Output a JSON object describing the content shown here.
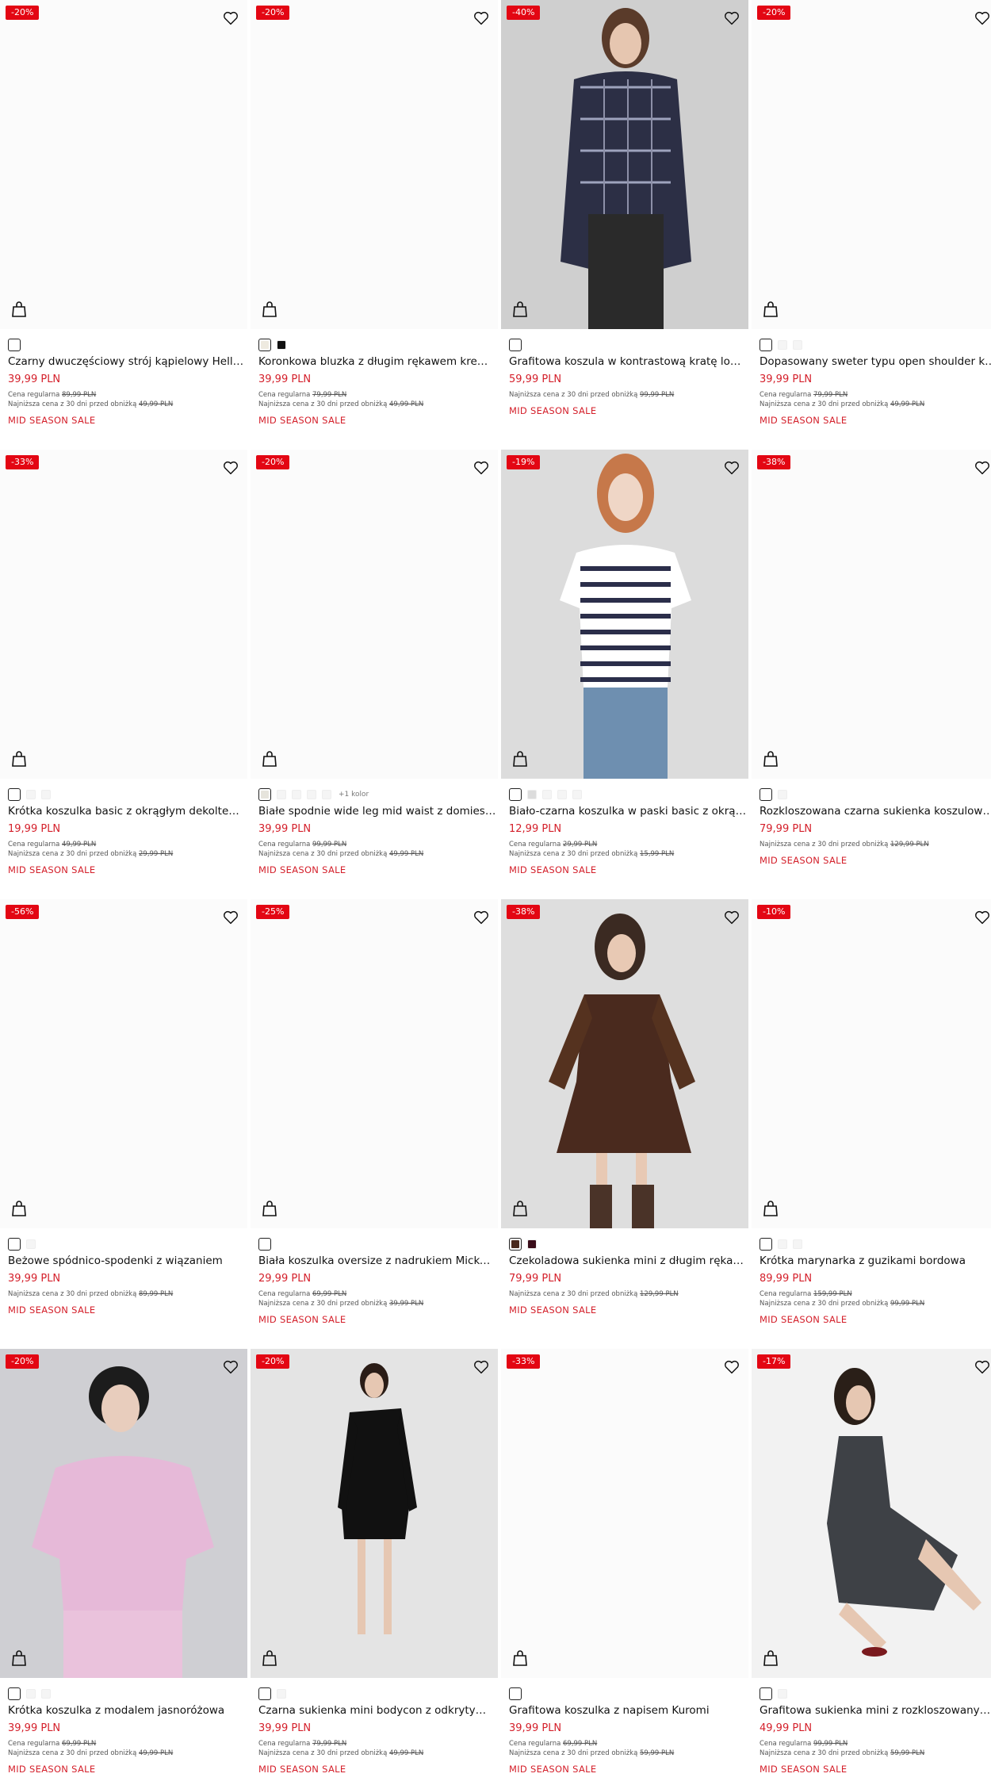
{
  "labels": {
    "regular": "Cena regularna",
    "lowest": "Najniższa cena z 30 dni przed obniżką"
  },
  "colors": {
    "accent": "#d41f2a",
    "badge": "#e30613"
  },
  "products": [
    {
      "badge": "-20%",
      "name": "Czarny dwuczęściowy strój kąpielowy Hello Kitty",
      "price": "39,99 PLN",
      "regular": "89,99 PLN",
      "lowest": "49,99 PLN",
      "sale": "MID SEASON SALE",
      "swatches": [
        "#ffffff"
      ],
      "more": "",
      "photo": "none"
    },
    {
      "badge": "-20%",
      "name": "Koronkowa bluzka z długim rękawem kremowa",
      "price": "39,99 PLN",
      "regular": "79,99 PLN",
      "lowest": "49,99 PLN",
      "sale": "MID SEASON SALE",
      "swatches": [
        "#eeeae0",
        "#111111"
      ],
      "more": "",
      "photo": "none"
    },
    {
      "badge": "-40%",
      "name": "Grafitowa koszula w kontrastową kratę loose fit",
      "price": "59,99 PLN",
      "regular": "",
      "lowest": "99,99 PLN",
      "sale": "MID SEASON SALE",
      "swatches": [
        "#ffffff"
      ],
      "more": "",
      "photo": "shirt"
    },
    {
      "badge": "-20%",
      "name": "Dopasowany sweter typu open shoulder kremowy",
      "price": "39,99 PLN",
      "regular": "79,99 PLN",
      "lowest": "49,99 PLN",
      "sale": "MID SEASON SALE",
      "swatches": [
        "#ffffff",
        "#f5f5f5",
        "#f5f5f5"
      ],
      "more": "",
      "photo": "none"
    },
    {
      "badge": "-33%",
      "name": "Krótka koszulka basic z okrągłym dekoltem czarna",
      "price": "19,99 PLN",
      "regular": "49,99 PLN",
      "lowest": "29,99 PLN",
      "sale": "MID SEASON SALE",
      "swatches": [
        "#ffffff",
        "#f5f5f5",
        "#f5f5f5"
      ],
      "more": "",
      "photo": "none"
    },
    {
      "badge": "-20%",
      "name": "Białe spodnie wide leg mid waist z domieszką lnu",
      "price": "39,99 PLN",
      "regular": "99,99 PLN",
      "lowest": "49,99 PLN",
      "sale": "MID SEASON SALE",
      "swatches": [
        "#e6e4dc",
        "#f5f5f5",
        "#f5f5f5",
        "#f5f5f5",
        "#f5f5f5"
      ],
      "more": "+1 kolor",
      "photo": "none"
    },
    {
      "badge": "-19%",
      "name": "Biało-czarna koszulka w paski basic z okrągłym dekoltem",
      "price": "12,99 PLN",
      "regular": "29,99 PLN",
      "lowest": "15,99 PLN",
      "sale": "MID SEASON SALE",
      "swatches": [
        "#ffffff",
        "#dcdcdc",
        "#f5f5f5",
        "#f5f5f5",
        "#f5f5f5"
      ],
      "more": "",
      "photo": "stripe"
    },
    {
      "badge": "-38%",
      "name": "Rozkloszowana czarna sukienka koszulowa mini",
      "price": "79,99 PLN",
      "regular": "",
      "lowest": "129,99 PLN",
      "sale": "MID SEASON SALE",
      "swatches": [
        "#ffffff",
        "#f5f5f5"
      ],
      "more": "",
      "photo": "none"
    },
    {
      "badge": "-56%",
      "name": "Beżowe spódnico-spodenki z wiązaniem",
      "price": "39,99 PLN",
      "regular": "",
      "lowest": "89,99 PLN",
      "sale": "MID SEASON SALE",
      "swatches": [
        "#ffffff",
        "#f5f5f5"
      ],
      "more": "",
      "photo": "none"
    },
    {
      "badge": "-25%",
      "name": "Biała koszulka oversize z nadrukiem Mickey Mouse",
      "price": "29,99 PLN",
      "regular": "69,99 PLN",
      "lowest": "39,99 PLN",
      "sale": "MID SEASON SALE",
      "swatches": [
        "#ffffff"
      ],
      "more": "",
      "photo": "none"
    },
    {
      "badge": "-38%",
      "name": "Czekoladowa sukienka mini z długim rękawem",
      "price": "79,99 PLN",
      "regular": "",
      "lowest": "129,99 PLN",
      "sale": "MID SEASON SALE",
      "swatches": [
        "#4a2a1e",
        "#3a0d1a"
      ],
      "more": "",
      "photo": "dress"
    },
    {
      "badge": "-10%",
      "name": "Krótka marynarka z guzikami bordowa",
      "price": "89,99 PLN",
      "regular": "159,99 PLN",
      "lowest": "99,99 PLN",
      "sale": "MID SEASON SALE",
      "swatches": [
        "#ffffff",
        "#f5f5f5",
        "#f5f5f5"
      ],
      "more": "",
      "photo": "none"
    },
    {
      "badge": "-20%",
      "name": "Krótka koszulka z modalem jasnoróżowa",
      "price": "39,99 PLN",
      "regular": "69,99 PLN",
      "lowest": "49,99 PLN",
      "sale": "MID SEASON SALE",
      "swatches": [
        "#ffffff",
        "#f5f5f5",
        "#f5f5f5"
      ],
      "more": "",
      "photo": "pink"
    },
    {
      "badge": "-20%",
      "name": "Czarna sukienka mini bodycon z odkrytym ramieniem",
      "price": "39,99 PLN",
      "regular": "79,99 PLN",
      "lowest": "49,99 PLN",
      "sale": "MID SEASON SALE",
      "swatches": [
        "#ffffff",
        "#f5f5f5"
      ],
      "more": "",
      "photo": "blackdress"
    },
    {
      "badge": "-33%",
      "name": "Grafitowa koszulka z napisem Kuromi",
      "price": "39,99 PLN",
      "regular": "69,99 PLN",
      "lowest": "59,99 PLN",
      "sale": "MID SEASON SALE",
      "swatches": [
        "#ffffff"
      ],
      "more": "",
      "photo": "none"
    },
    {
      "badge": "-17%",
      "name": "Grafitowa sukienka mini z rozkloszowanym dołem",
      "price": "49,99 PLN",
      "regular": "99,99 PLN",
      "lowest": "59,99 PLN",
      "sale": "MID SEASON SALE",
      "swatches": [
        "#ffffff",
        "#f5f5f5"
      ],
      "more": "",
      "photo": "greydress"
    }
  ]
}
